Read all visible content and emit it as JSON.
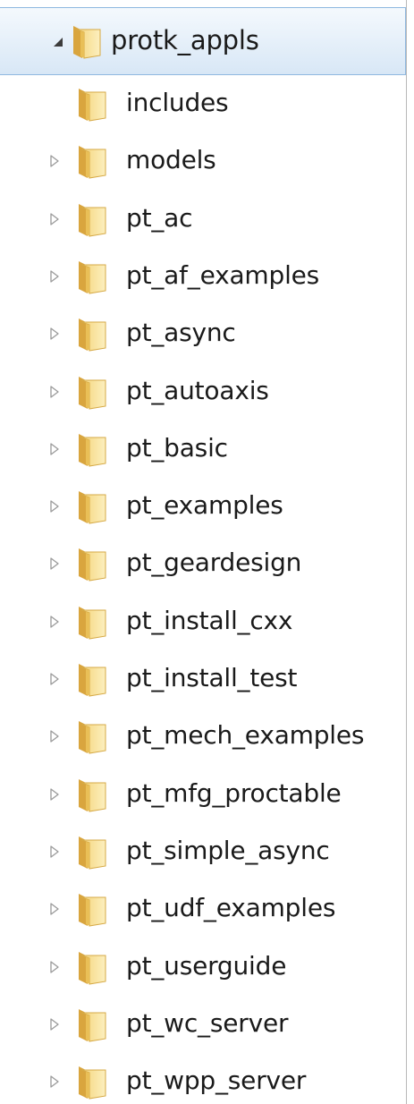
{
  "tree": {
    "root": {
      "label": "protk_appls",
      "expanded": true,
      "icon": "folder-open-icon"
    },
    "children": [
      {
        "label": "includes",
        "has_children": false
      },
      {
        "label": "models",
        "has_children": true
      },
      {
        "label": "pt_ac",
        "has_children": true
      },
      {
        "label": "pt_af_examples",
        "has_children": true
      },
      {
        "label": "pt_async",
        "has_children": true
      },
      {
        "label": "pt_autoaxis",
        "has_children": true
      },
      {
        "label": "pt_basic",
        "has_children": true
      },
      {
        "label": "pt_examples",
        "has_children": true
      },
      {
        "label": "pt_geardesign",
        "has_children": true
      },
      {
        "label": "pt_install_cxx",
        "has_children": true
      },
      {
        "label": "pt_install_test",
        "has_children": true
      },
      {
        "label": "pt_mech_examples",
        "has_children": true
      },
      {
        "label": "pt_mfg_proctable",
        "has_children": true
      },
      {
        "label": "pt_simple_async",
        "has_children": true
      },
      {
        "label": "pt_udf_examples",
        "has_children": true
      },
      {
        "label": "pt_userguide",
        "has_children": true
      },
      {
        "label": "pt_wc_server",
        "has_children": true
      },
      {
        "label": "pt_wpp_server",
        "has_children": true
      }
    ]
  },
  "colors": {
    "selection_top": "#f4f9fd",
    "selection_bottom": "#d8e7f6",
    "selection_border": "#8fb8e0",
    "folder_light": "#fbe6a3",
    "folder_dark": "#e0b54d",
    "twisty_collapsed": "#9a9a9a",
    "twisty_expanded": "#3c3c3c"
  }
}
